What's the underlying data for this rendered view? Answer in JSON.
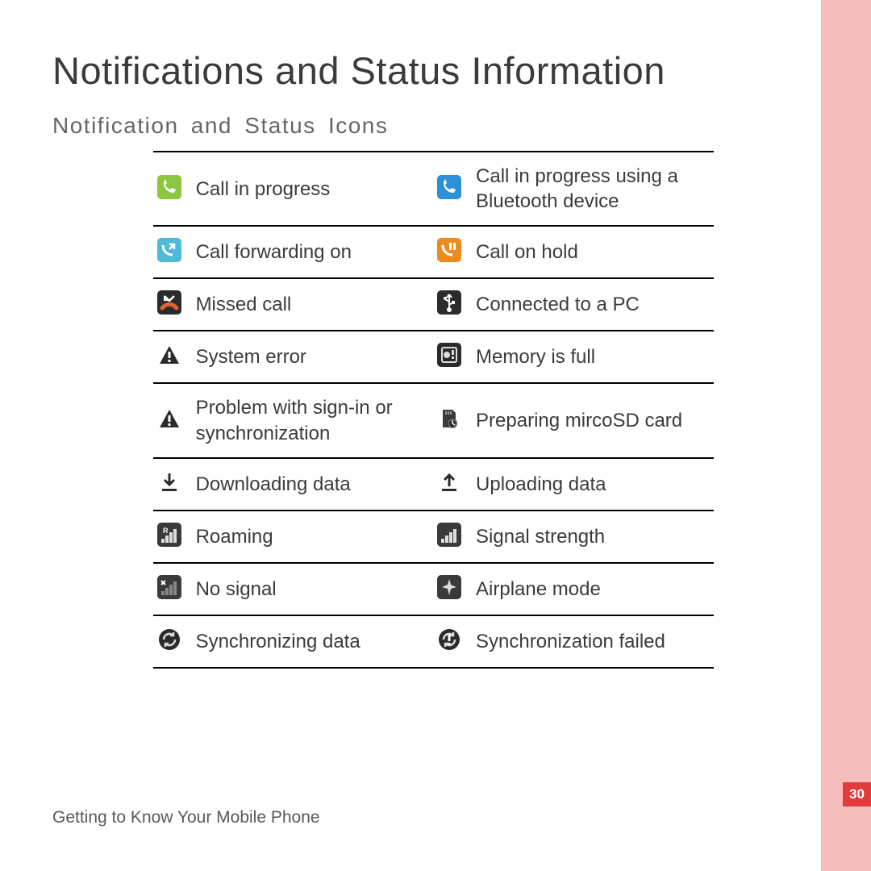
{
  "title": "Notifications and Status Information",
  "subtitle": "Notification and Status Icons",
  "footer": "Getting to Know Your Mobile Phone",
  "pagenum": "30",
  "rows": [
    {
      "l": "Call in progress",
      "r": "Call in progress using a Bluetooth device"
    },
    {
      "l": "Call forwarding on",
      "r": "Call on hold"
    },
    {
      "l": "Missed call",
      "r": "Connected to a PC"
    },
    {
      "l": "System error",
      "r": "Memory is full"
    },
    {
      "l": "Problem with sign-in or synchronization",
      "r": "Preparing mircoSD card"
    },
    {
      "l": "Downloading data",
      "r": "Uploading data"
    },
    {
      "l": "Roaming",
      "r": "Signal strength"
    },
    {
      "l": "No signal",
      "r": "Airplane mode"
    },
    {
      "l": "Synchronizing data",
      "r": "Synchronization failed"
    }
  ]
}
